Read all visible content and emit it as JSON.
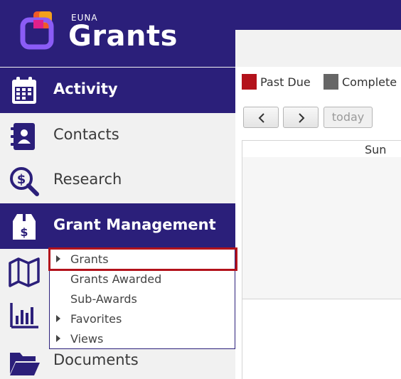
{
  "brand": {
    "small_label": "EUNA",
    "name": "Grants"
  },
  "sidebar": {
    "items": [
      {
        "label": "Activity",
        "icon": "calendar-icon",
        "active": true
      },
      {
        "label": "Contacts",
        "icon": "address-book-icon",
        "active": false
      },
      {
        "label": "Research",
        "icon": "dollar-search-icon",
        "active": false
      },
      {
        "label": "Grant Management",
        "icon": "dollar-box-icon",
        "active": true
      },
      {
        "label": "Documents",
        "icon": "folder-icon",
        "active": false
      }
    ],
    "extra_icons": [
      "map-icon",
      "bar-chart-icon"
    ],
    "submenu": [
      {
        "label": "Grants",
        "expandable": true,
        "highlighted": true
      },
      {
        "label": "Grants Awarded",
        "expandable": false
      },
      {
        "label": "Sub-Awards",
        "expandable": false
      },
      {
        "label": "Favorites",
        "expandable": true
      },
      {
        "label": "Views",
        "expandable": true
      }
    ]
  },
  "calendar": {
    "legend": [
      {
        "label": "Past Due",
        "color": "#b3121b"
      },
      {
        "label": "Complete",
        "color": "#666666"
      }
    ],
    "prev_icon": "chevron-left-icon",
    "next_icon": "chevron-right-icon",
    "today_label": "today",
    "day_header": "Sun"
  },
  "colors": {
    "brand": "#2b1f7a",
    "highlight": "#b3121b"
  }
}
